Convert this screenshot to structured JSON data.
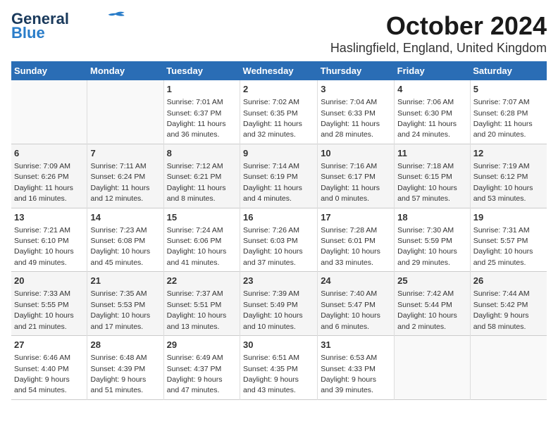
{
  "logo": {
    "line1": "General",
    "line2": "Blue"
  },
  "title": "October 2024",
  "location": "Haslingfield, England, United Kingdom",
  "days_of_week": [
    "Sunday",
    "Monday",
    "Tuesday",
    "Wednesday",
    "Thursday",
    "Friday",
    "Saturday"
  ],
  "weeks": [
    [
      {
        "day": "",
        "info": ""
      },
      {
        "day": "",
        "info": ""
      },
      {
        "day": "1",
        "info": "Sunrise: 7:01 AM\nSunset: 6:37 PM\nDaylight: 11 hours\nand 36 minutes."
      },
      {
        "day": "2",
        "info": "Sunrise: 7:02 AM\nSunset: 6:35 PM\nDaylight: 11 hours\nand 32 minutes."
      },
      {
        "day": "3",
        "info": "Sunrise: 7:04 AM\nSunset: 6:33 PM\nDaylight: 11 hours\nand 28 minutes."
      },
      {
        "day": "4",
        "info": "Sunrise: 7:06 AM\nSunset: 6:30 PM\nDaylight: 11 hours\nand 24 minutes."
      },
      {
        "day": "5",
        "info": "Sunrise: 7:07 AM\nSunset: 6:28 PM\nDaylight: 11 hours\nand 20 minutes."
      }
    ],
    [
      {
        "day": "6",
        "info": "Sunrise: 7:09 AM\nSunset: 6:26 PM\nDaylight: 11 hours\nand 16 minutes."
      },
      {
        "day": "7",
        "info": "Sunrise: 7:11 AM\nSunset: 6:24 PM\nDaylight: 11 hours\nand 12 minutes."
      },
      {
        "day": "8",
        "info": "Sunrise: 7:12 AM\nSunset: 6:21 PM\nDaylight: 11 hours\nand 8 minutes."
      },
      {
        "day": "9",
        "info": "Sunrise: 7:14 AM\nSunset: 6:19 PM\nDaylight: 11 hours\nand 4 minutes."
      },
      {
        "day": "10",
        "info": "Sunrise: 7:16 AM\nSunset: 6:17 PM\nDaylight: 11 hours\nand 0 minutes."
      },
      {
        "day": "11",
        "info": "Sunrise: 7:18 AM\nSunset: 6:15 PM\nDaylight: 10 hours\nand 57 minutes."
      },
      {
        "day": "12",
        "info": "Sunrise: 7:19 AM\nSunset: 6:12 PM\nDaylight: 10 hours\nand 53 minutes."
      }
    ],
    [
      {
        "day": "13",
        "info": "Sunrise: 7:21 AM\nSunset: 6:10 PM\nDaylight: 10 hours\nand 49 minutes."
      },
      {
        "day": "14",
        "info": "Sunrise: 7:23 AM\nSunset: 6:08 PM\nDaylight: 10 hours\nand 45 minutes."
      },
      {
        "day": "15",
        "info": "Sunrise: 7:24 AM\nSunset: 6:06 PM\nDaylight: 10 hours\nand 41 minutes."
      },
      {
        "day": "16",
        "info": "Sunrise: 7:26 AM\nSunset: 6:03 PM\nDaylight: 10 hours\nand 37 minutes."
      },
      {
        "day": "17",
        "info": "Sunrise: 7:28 AM\nSunset: 6:01 PM\nDaylight: 10 hours\nand 33 minutes."
      },
      {
        "day": "18",
        "info": "Sunrise: 7:30 AM\nSunset: 5:59 PM\nDaylight: 10 hours\nand 29 minutes."
      },
      {
        "day": "19",
        "info": "Sunrise: 7:31 AM\nSunset: 5:57 PM\nDaylight: 10 hours\nand 25 minutes."
      }
    ],
    [
      {
        "day": "20",
        "info": "Sunrise: 7:33 AM\nSunset: 5:55 PM\nDaylight: 10 hours\nand 21 minutes."
      },
      {
        "day": "21",
        "info": "Sunrise: 7:35 AM\nSunset: 5:53 PM\nDaylight: 10 hours\nand 17 minutes."
      },
      {
        "day": "22",
        "info": "Sunrise: 7:37 AM\nSunset: 5:51 PM\nDaylight: 10 hours\nand 13 minutes."
      },
      {
        "day": "23",
        "info": "Sunrise: 7:39 AM\nSunset: 5:49 PM\nDaylight: 10 hours\nand 10 minutes."
      },
      {
        "day": "24",
        "info": "Sunrise: 7:40 AM\nSunset: 5:47 PM\nDaylight: 10 hours\nand 6 minutes."
      },
      {
        "day": "25",
        "info": "Sunrise: 7:42 AM\nSunset: 5:44 PM\nDaylight: 10 hours\nand 2 minutes."
      },
      {
        "day": "26",
        "info": "Sunrise: 7:44 AM\nSunset: 5:42 PM\nDaylight: 9 hours\nand 58 minutes."
      }
    ],
    [
      {
        "day": "27",
        "info": "Sunrise: 6:46 AM\nSunset: 4:40 PM\nDaylight: 9 hours\nand 54 minutes."
      },
      {
        "day": "28",
        "info": "Sunrise: 6:48 AM\nSunset: 4:39 PM\nDaylight: 9 hours\nand 51 minutes."
      },
      {
        "day": "29",
        "info": "Sunrise: 6:49 AM\nSunset: 4:37 PM\nDaylight: 9 hours\nand 47 minutes."
      },
      {
        "day": "30",
        "info": "Sunrise: 6:51 AM\nSunset: 4:35 PM\nDaylight: 9 hours\nand 43 minutes."
      },
      {
        "day": "31",
        "info": "Sunrise: 6:53 AM\nSunset: 4:33 PM\nDaylight: 9 hours\nand 39 minutes."
      },
      {
        "day": "",
        "info": ""
      },
      {
        "day": "",
        "info": ""
      }
    ]
  ]
}
